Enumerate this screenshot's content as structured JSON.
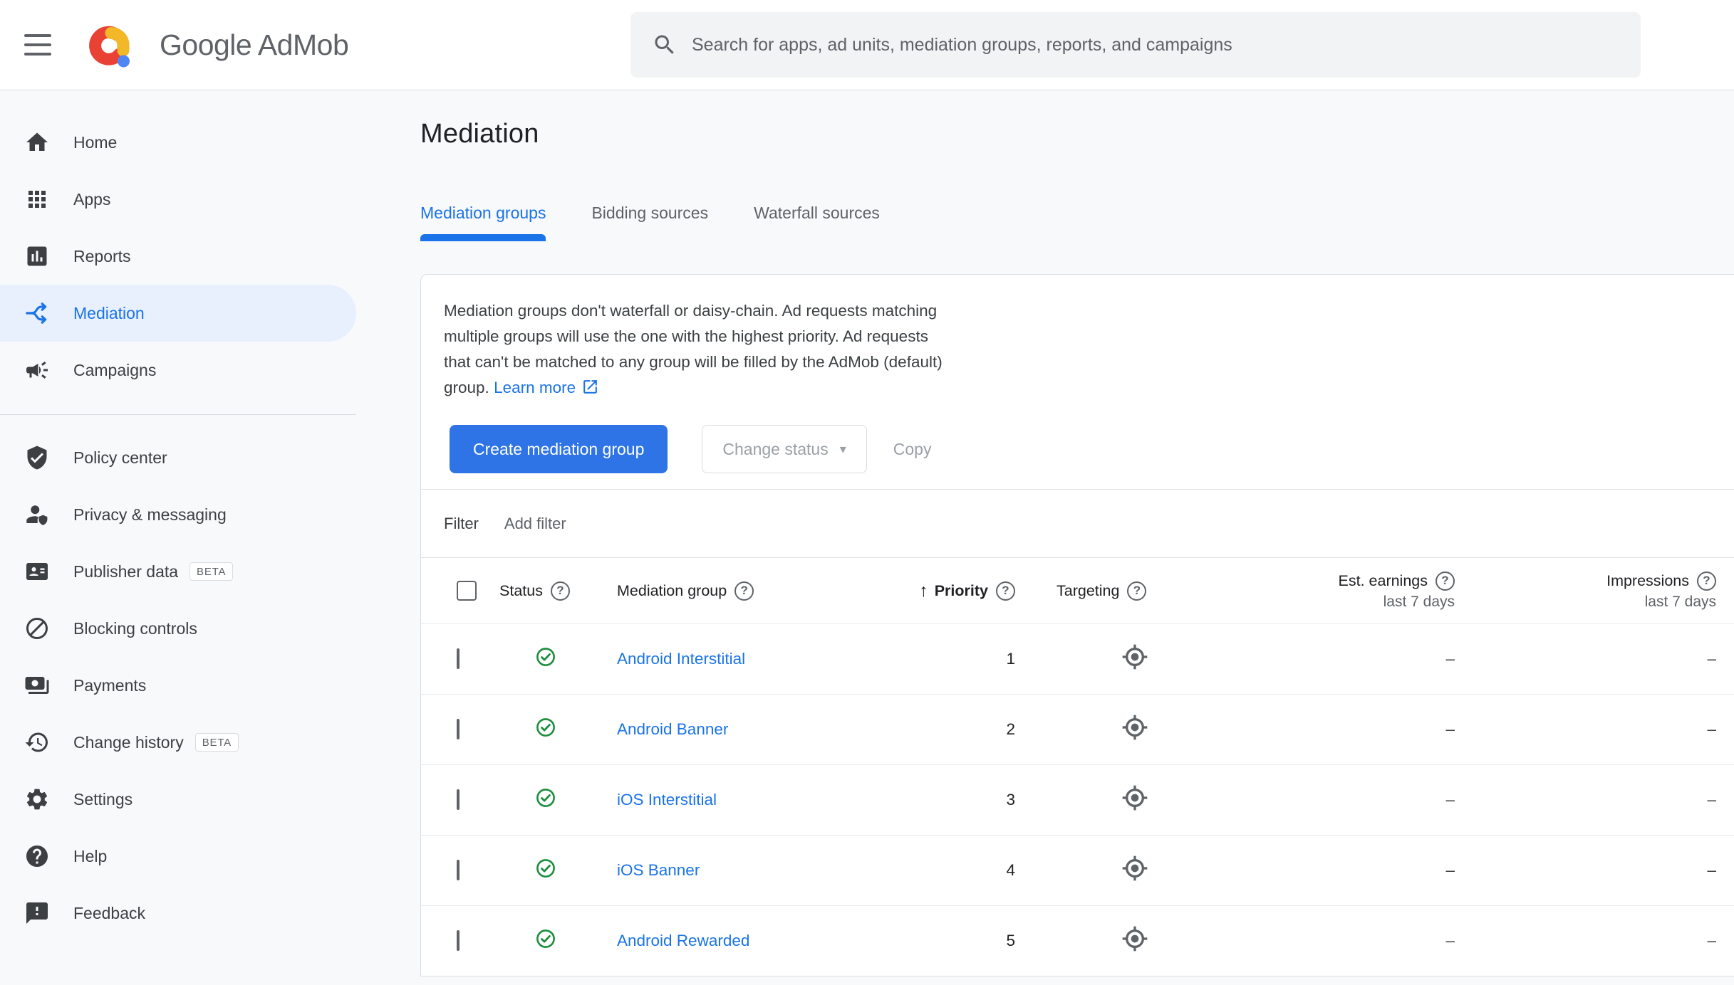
{
  "header": {
    "brand": "Google AdMob",
    "search_placeholder": "Search for apps, ad units, mediation groups, reports, and campaigns"
  },
  "sidebar": {
    "primary": [
      {
        "label": "Home",
        "icon": "home-icon"
      },
      {
        "label": "Apps",
        "icon": "apps-icon"
      },
      {
        "label": "Reports",
        "icon": "reports-icon"
      },
      {
        "label": "Mediation",
        "icon": "mediation-icon",
        "selected": true
      },
      {
        "label": "Campaigns",
        "icon": "campaigns-icon"
      }
    ],
    "secondary": [
      {
        "label": "Policy center",
        "icon": "policy-shield-icon"
      },
      {
        "label": "Privacy & messaging",
        "icon": "privacy-person-icon"
      },
      {
        "label": "Publisher data",
        "icon": "publisher-data-icon",
        "badge": "BETA"
      },
      {
        "label": "Blocking controls",
        "icon": "blocking-icon"
      },
      {
        "label": "Payments",
        "icon": "payments-icon"
      },
      {
        "label": "Change history",
        "icon": "history-icon",
        "badge": "BETA"
      },
      {
        "label": "Settings",
        "icon": "settings-gear-icon"
      },
      {
        "label": "Help",
        "icon": "help-icon"
      },
      {
        "label": "Feedback",
        "icon": "feedback-icon"
      }
    ]
  },
  "main": {
    "title": "Mediation",
    "tabs": [
      {
        "label": "Mediation groups",
        "active": true
      },
      {
        "label": "Bidding sources",
        "active": false
      },
      {
        "label": "Waterfall sources",
        "active": false
      }
    ],
    "notice": {
      "lines": [
        "Mediation groups don't waterfall or daisy-chain. Ad requests matching",
        "multiple groups will use the one with the highest priority. Ad requests",
        "that can't be matched to any group will be filled by the AdMob (default)",
        "group."
      ],
      "link_label": "Learn more"
    },
    "actions": {
      "create": "Create mediation group",
      "change_status": "Change status",
      "copy": "Copy"
    },
    "filter": {
      "label": "Filter",
      "add_label": "Add filter"
    },
    "table": {
      "headers": {
        "status": "Status",
        "group": "Mediation group",
        "priority": "Priority",
        "targeting": "Targeting",
        "earnings": "Est. earnings",
        "earnings_sub": "last 7 days",
        "impressions": "Impressions",
        "impressions_sub": "last 7 days"
      },
      "rows": [
        {
          "name": "Android Interstitial",
          "priority": "1",
          "earnings": "–",
          "impressions": "–"
        },
        {
          "name": "Android Banner",
          "priority": "2",
          "earnings": "–",
          "impressions": "–"
        },
        {
          "name": "iOS Interstitial",
          "priority": "3",
          "earnings": "–",
          "impressions": "–"
        },
        {
          "name": "iOS Banner",
          "priority": "4",
          "earnings": "–",
          "impressions": "–"
        },
        {
          "name": "Android Rewarded",
          "priority": "5",
          "earnings": "–",
          "impressions": "–"
        }
      ]
    }
  },
  "misc": {
    "q": "?",
    "caret": "▾",
    "sort_arrow": "↑"
  },
  "colors": {
    "accent_blue": "#1A73E8",
    "button_blue": "#2E74E6",
    "status_green": "#1E8E3E",
    "selected_bg": "#E8F0FE",
    "logo_red": "#E94235",
    "logo_yellow": "#F2B827",
    "logo_blue": "#4E86F5"
  }
}
